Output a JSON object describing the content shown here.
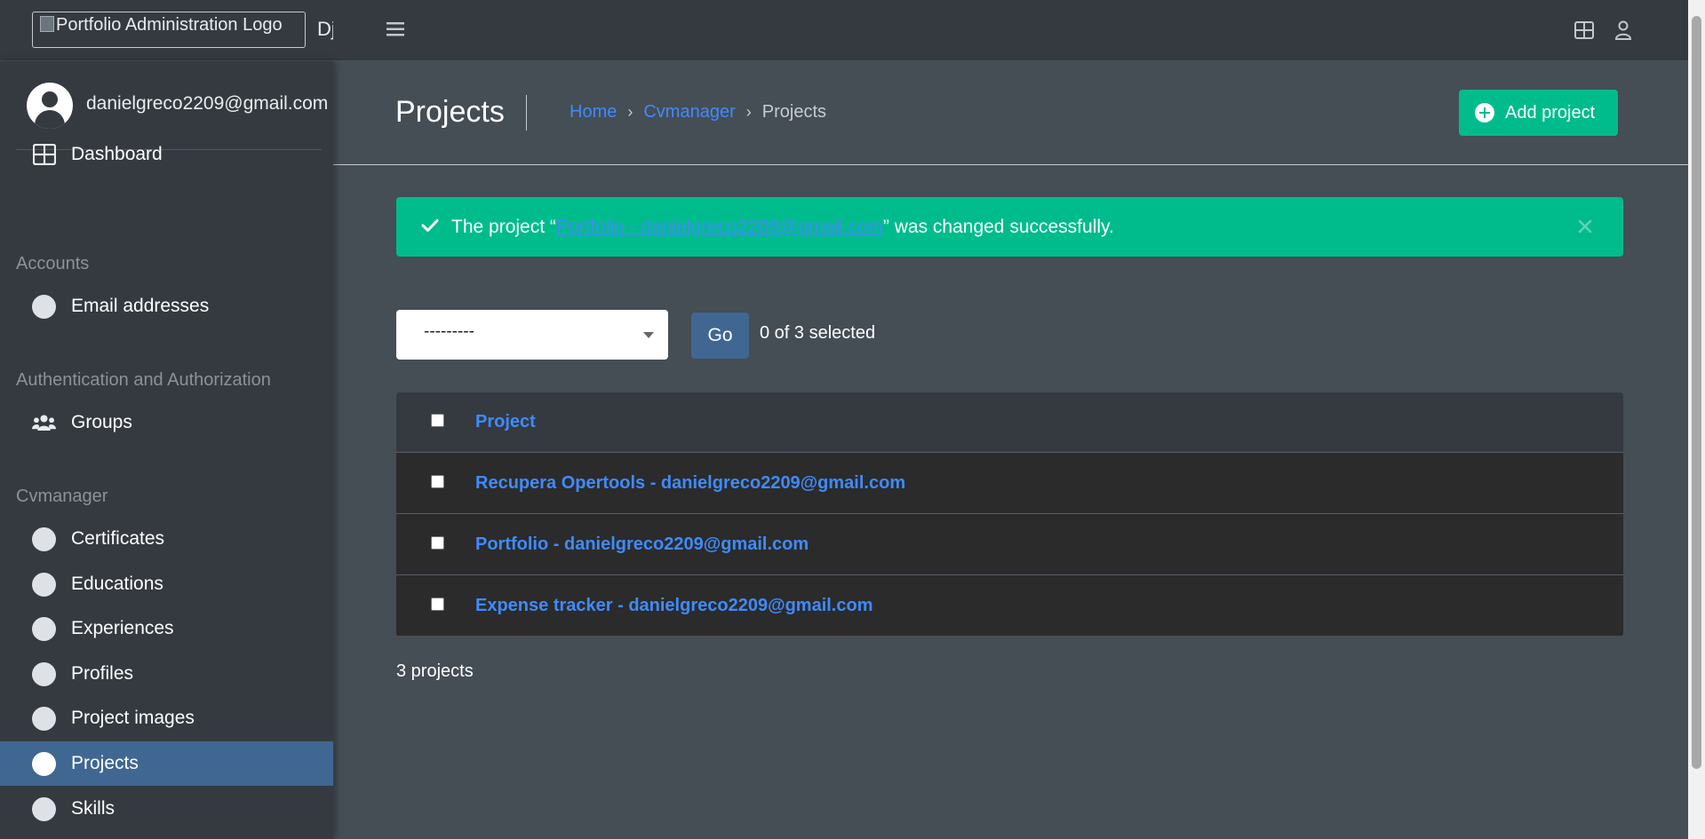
{
  "topbar": {
    "logo_alt": "Portfolio Administration Logo",
    "brand_text": "Django",
    "icons": [
      "hamburger-icon",
      "apps-grid-icon",
      "user-icon"
    ]
  },
  "sidebar": {
    "user_email": "danielgreco2209@gmail.com",
    "dashboard": "Dashboard",
    "sections": [
      {
        "header": "Accounts",
        "items": [
          "Email addresses"
        ]
      },
      {
        "header": "Authentication and Authorization",
        "items": [
          "Groups"
        ]
      },
      {
        "header": "Cvmanager",
        "items": [
          "Certificates",
          "Educations",
          "Experiences",
          "Profiles",
          "Project images",
          "Projects",
          "Skills"
        ]
      }
    ],
    "active_item": "Projects"
  },
  "header": {
    "title": "Projects",
    "breadcrumb": [
      "Home",
      "Cvmanager",
      "Projects"
    ],
    "breadcrumb_separator": "›",
    "add_button": "Add project"
  },
  "alert": {
    "prefix": "The project “",
    "link": "Portfolio - danielgreco2209@gmail.com",
    "suffix": "” was changed successfully.",
    "close": "×"
  },
  "actions": {
    "select_value": "---------",
    "go_label": "Go",
    "selected_text": "0 of 3 selected"
  },
  "table": {
    "column_header": "Project",
    "rows": [
      "Recupera Opertools - danielgreco2209@gmail.com",
      "Portfolio - danielgreco2209@gmail.com",
      "Expense tracker - danielgreco2209@gmail.com"
    ],
    "count_text": "3 projects"
  },
  "colors": {
    "background": "#454d55",
    "sidebar": "#343a40",
    "active": "#3f6791",
    "success": "#00bc8c",
    "link": "#3f8bfd",
    "table_row": "#2b2b2b"
  }
}
